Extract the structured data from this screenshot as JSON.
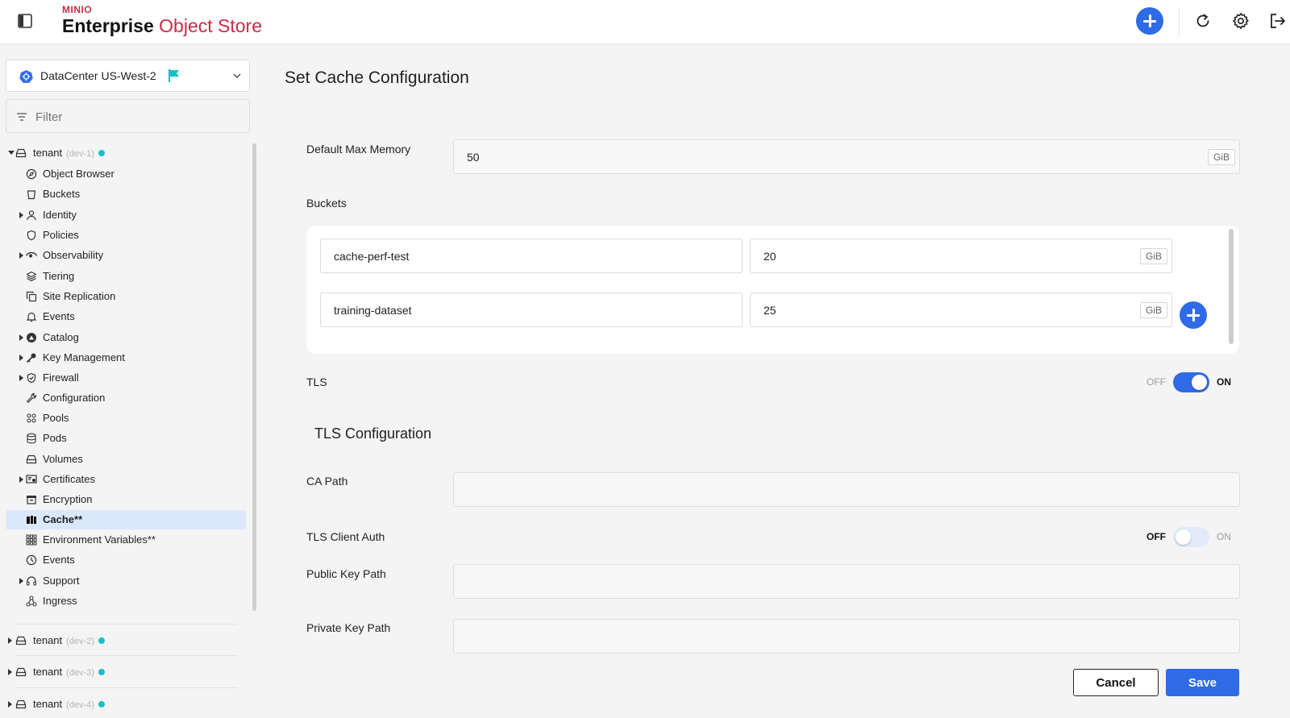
{
  "header": {
    "brand_small": "MINIO",
    "brand_enterprise": "Enterprise",
    "brand_object_store": "Object Store"
  },
  "sidebar": {
    "datacenter": "DataCenter US-West-2",
    "filter_placeholder": "Filter",
    "tenants": [
      {
        "name": "tenant",
        "sub": "(dev-1)",
        "expanded": true
      },
      {
        "name": "tenant",
        "sub": "(dev-2)",
        "expanded": false
      },
      {
        "name": "tenant",
        "sub": "(dev-3)",
        "expanded": false
      },
      {
        "name": "tenant",
        "sub": "(dev-4)",
        "expanded": false
      }
    ],
    "items": [
      {
        "label": "Object Browser",
        "icon": "compass-icon"
      },
      {
        "label": "Buckets",
        "icon": "bucket-icon"
      },
      {
        "label": "Identity",
        "icon": "user-icon",
        "expandable": true
      },
      {
        "label": "Policies",
        "icon": "shield-icon"
      },
      {
        "label": "Observability",
        "icon": "observability-icon",
        "expandable": true
      },
      {
        "label": "Tiering",
        "icon": "layers-icon"
      },
      {
        "label": "Site Replication",
        "icon": "copy-icon"
      },
      {
        "label": "Events",
        "icon": "bell-icon"
      },
      {
        "label": "Catalog",
        "icon": "catalog-icon",
        "expandable": true
      },
      {
        "label": "Key Management",
        "icon": "key-icon",
        "expandable": true
      },
      {
        "label": "Firewall",
        "icon": "shield-check-icon",
        "expandable": true
      },
      {
        "label": "Configuration",
        "icon": "wrench-icon"
      },
      {
        "label": "Pools",
        "icon": "pools-icon"
      },
      {
        "label": "Pods",
        "icon": "database-icon"
      },
      {
        "label": "Volumes",
        "icon": "drive-icon"
      },
      {
        "label": "Certificates",
        "icon": "certificate-icon",
        "expandable": true
      },
      {
        "label": "Encryption",
        "icon": "archive-icon"
      },
      {
        "label": "Cache**",
        "icon": "cache-icon",
        "active": true
      },
      {
        "label": "Environment Variables**",
        "icon": "grid-icon"
      },
      {
        "label": "Events",
        "icon": "clock-icon"
      },
      {
        "label": "Support",
        "icon": "headset-icon",
        "expandable": true
      },
      {
        "label": "Ingress",
        "icon": "network-icon"
      }
    ]
  },
  "main": {
    "title": "Set Cache Configuration",
    "default_max_memory_label": "Default Max Memory",
    "default_max_memory_value": "50",
    "unit": "GiB",
    "buckets_label": "Buckets",
    "buckets": [
      {
        "name": "cache-perf-test",
        "size": "20"
      },
      {
        "name": "training-dataset",
        "size": "25"
      }
    ],
    "tls_label": "TLS",
    "toggle_off": "OFF",
    "toggle_on": "ON",
    "tls_enabled": true,
    "tls_config_title": "TLS Configuration",
    "ca_path_label": "CA Path",
    "ca_path_value": "",
    "tls_client_auth_label": "TLS Client Auth",
    "tls_client_auth_enabled": false,
    "public_key_label": "Public Key Path",
    "public_key_value": "",
    "private_key_label": "Private Key Path",
    "private_key_value": "",
    "cancel_label": "Cancel",
    "save_label": "Save"
  },
  "colors": {
    "accent": "#2f6be6",
    "brand": "#c72c48",
    "status_dot": "#17c1c9",
    "active_bg": "#dbe8fb"
  }
}
